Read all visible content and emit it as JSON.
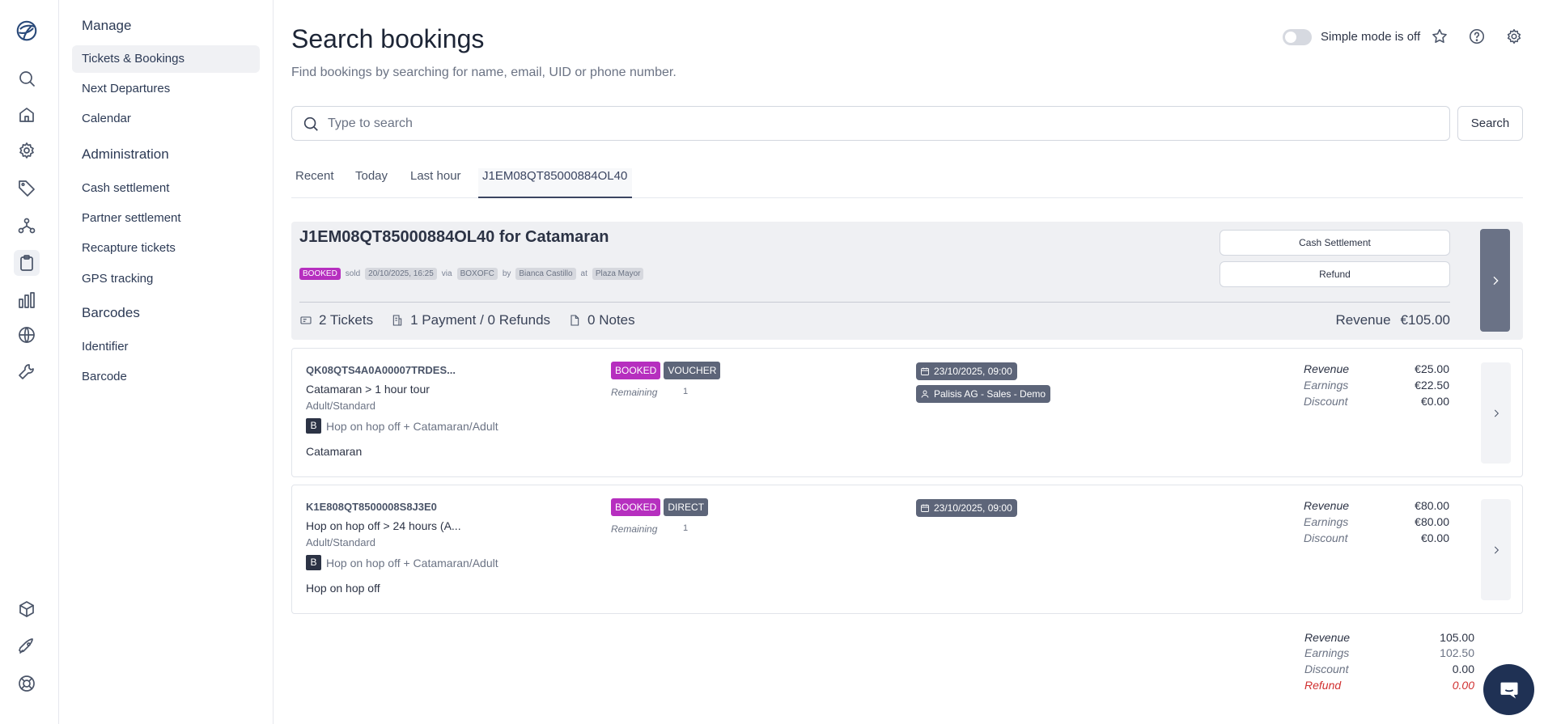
{
  "rail": {
    "icons": [
      "logo-icon",
      "search-icon",
      "home-icon",
      "gear-icon",
      "tag-icon",
      "network-icon",
      "clipboard-icon",
      "bar-chart-icon",
      "globe-icon",
      "wrench-icon",
      "cube-icon",
      "rocket-icon",
      "lifebuoy-icon"
    ]
  },
  "menu": {
    "manage_heading": "Manage",
    "manage_items": [
      "Tickets & Bookings",
      "Next Departures",
      "Calendar"
    ],
    "admin_heading": "Administration",
    "admin_items": [
      "Cash settlement",
      "Partner settlement",
      "Recapture tickets",
      "GPS tracking"
    ],
    "barcodes_heading": "Barcodes",
    "barcodes_items": [
      "Identifier",
      "Barcode"
    ]
  },
  "header": {
    "title": "Search bookings",
    "subtitle": "Find bookings by searching for name, email, UID or phone number.",
    "simple_mode_label": "Simple mode is off"
  },
  "search": {
    "placeholder": "Type to search",
    "button_label": "Search"
  },
  "tabs": [
    "Recent",
    "Today",
    "Last hour",
    "J1EM08QT85000884OL40"
  ],
  "booking": {
    "title": "J1EM08QT85000884OL40 for Catamaran",
    "status": "BOOKED",
    "sold_label": "sold",
    "sold_date": "20/10/2025, 16:25",
    "via_label": "via",
    "via_value": "BOXOFC",
    "by_label": "by",
    "by_value": "Bianca Castillo",
    "at_label": "at",
    "at_value": "Plaza Mayor",
    "cash_settlement_label": "Cash Settlement",
    "refund_label": "Refund",
    "tickets_stat": "2 Tickets",
    "payments_stat": "1 Payment / 0 Refunds",
    "notes_stat": "0 Notes",
    "revenue_label": "Revenue",
    "revenue_value": "€105.00"
  },
  "tickets": [
    {
      "code": "QK08QTS4A0A00007TRDES...",
      "name": "Catamaran > 1 hour tour",
      "variant": "Adult/Standard",
      "product_badge": "B",
      "product": "Hop on hop off + Catamaran/Adult",
      "category": "Catamaran",
      "status": "BOOKED",
      "type": "VOUCHER",
      "remaining_label": "Remaining",
      "remaining_value": "1",
      "date": "23/10/2025, 09:00",
      "partner": "Palisis AG - Sales - Demo",
      "revenue_label": "Revenue",
      "revenue": "€25.00",
      "earnings_label": "Earnings",
      "earnings": "€22.50",
      "discount_label": "Discount",
      "discount": "€0.00"
    },
    {
      "code": "K1E808QT8500008S8J3E0",
      "name": "Hop on hop off > 24 hours (A...",
      "variant": "Adult/Standard",
      "product_badge": "B",
      "product": "Hop on hop off + Catamaran/Adult",
      "category": "Hop on hop off",
      "status": "BOOKED",
      "type": "DIRECT",
      "remaining_label": "Remaining",
      "remaining_value": "1",
      "date": "23/10/2025, 09:00",
      "partner": "",
      "revenue_label": "Revenue",
      "revenue": "€80.00",
      "earnings_label": "Earnings",
      "earnings": "€80.00",
      "discount_label": "Discount",
      "discount": "€0.00"
    }
  ],
  "totals": {
    "revenue_label": "Revenue",
    "revenue": "105.00",
    "earnings_label": "Earnings",
    "earnings": "102.50",
    "discount_label": "Discount",
    "discount": "0.00",
    "refund_label": "Refund",
    "refund": "0.00"
  },
  "colors": {
    "booked_badge": "#b62fbf",
    "type_badge": "#5d6579",
    "refund_text": "#d03030",
    "chat_button": "#1f3154"
  }
}
